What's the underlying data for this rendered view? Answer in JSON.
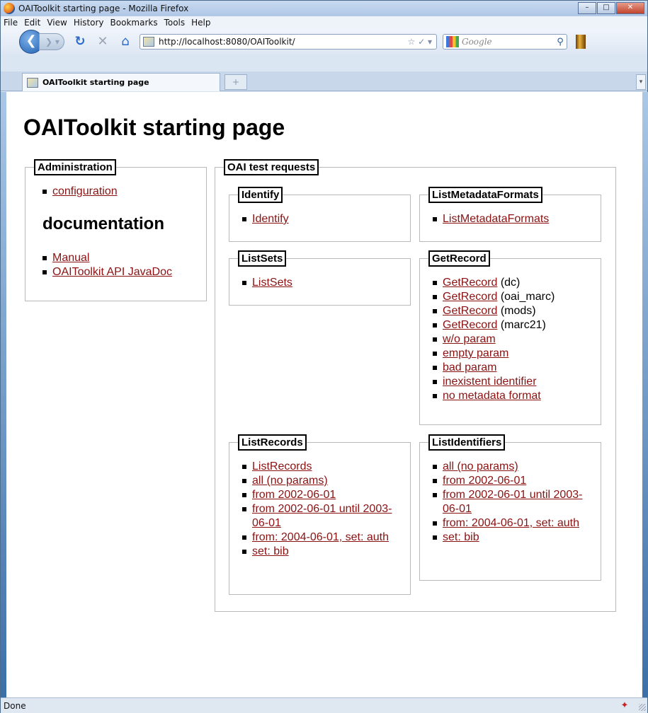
{
  "window": {
    "title": "OAIToolkit starting page - Mozilla Firefox"
  },
  "menu": [
    "File",
    "Edit",
    "View",
    "History",
    "Bookmarks",
    "Tools",
    "Help"
  ],
  "nav": {
    "url": "http://localhost:8080/OAIToolkit/",
    "search_placeholder": "Google"
  },
  "tab": {
    "label": "OAIToolkit starting page"
  },
  "page": {
    "title": "OAIToolkit starting page",
    "admin": {
      "legend": "Administration",
      "configuration": "configuration",
      "doc_heading": "documentation",
      "manual": "Manual",
      "javadoc": "OAIToolkit API JavaDoc"
    },
    "oai": {
      "legend": "OAI test requests",
      "identify": {
        "legend": "Identify",
        "links": [
          "Identify"
        ]
      },
      "listmetadataformats": {
        "legend": "ListMetadataFormats",
        "links": [
          "ListMetadataFormats"
        ]
      },
      "listsets": {
        "legend": "ListSets",
        "links": [
          "ListSets"
        ]
      },
      "getrecord": {
        "legend": "GetRecord",
        "items": [
          {
            "link": "GetRecord",
            "suffix": " (dc)"
          },
          {
            "link": "GetRecord",
            "suffix": " (oai_marc)"
          },
          {
            "link": "GetRecord",
            "suffix": " (mods)"
          },
          {
            "link": "GetRecord",
            "suffix": " (marc21)"
          },
          {
            "link": "w/o param",
            "suffix": ""
          },
          {
            "link": "empty param",
            "suffix": ""
          },
          {
            "link": "bad param",
            "suffix": ""
          },
          {
            "link": "inexistent identifier",
            "suffix": ""
          },
          {
            "link": "no metadata format",
            "suffix": ""
          }
        ]
      },
      "listrecords": {
        "legend": "ListRecords",
        "links": [
          "ListRecords",
          "all (no params)",
          "from 2002-06-01",
          "from 2002-06-01 until 2003-06-01",
          "from: 2004-06-01, set: auth",
          "set: bib"
        ]
      },
      "listidentifiers": {
        "legend": "ListIdentifiers",
        "links": [
          "all (no params)",
          "from 2002-06-01",
          "from 2002-06-01 until 2003-06-01",
          "from: 2004-06-01, set: auth",
          "set: bib"
        ]
      }
    }
  },
  "status": {
    "text": "Done"
  }
}
